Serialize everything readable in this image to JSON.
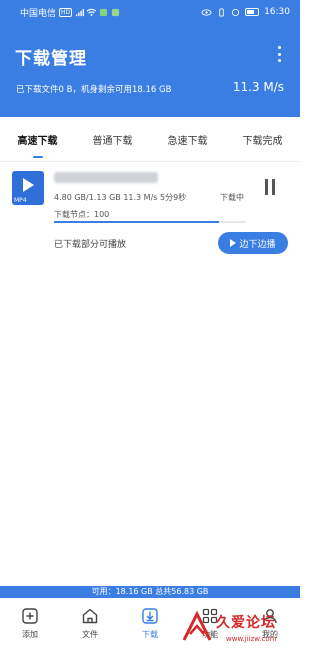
{
  "status_bar": {
    "carrier": "中国电信",
    "network": "HD",
    "time": "16:30"
  },
  "header": {
    "title": "下载管理",
    "storage_info": "已下载文件0 B，机身剩余可用18.16 GB",
    "speed": "11.3 M/s"
  },
  "tabs": [
    {
      "label": "高速下载",
      "active": true
    },
    {
      "label": "普通下载",
      "active": false
    },
    {
      "label": "急速下载",
      "active": false
    },
    {
      "label": "下载完成",
      "active": false
    }
  ],
  "download_item": {
    "file_format": "MP4",
    "file_name": "",
    "progress_text": "4.80 GB/1.13 GB  11.3 M/s  5分9秒",
    "status": "下载中",
    "nodes_text": "下载节点：100",
    "progress_fraction": 0.86,
    "partial_playable_text": "已下载部分可播放",
    "play_while_downloading_label": "边下边播"
  },
  "storage_bar": {
    "text": "可用：18.16 GB 总共56.83 GB"
  },
  "bottom_nav": [
    {
      "label": "添加",
      "icon": "add-icon",
      "active": false
    },
    {
      "label": "文件",
      "icon": "home-icon",
      "active": false
    },
    {
      "label": "下载",
      "icon": "download-icon",
      "active": true
    },
    {
      "label": "功能",
      "icon": "apps-icon",
      "active": false
    },
    {
      "label": "我的",
      "icon": "profile-icon",
      "active": false
    }
  ],
  "watermark": {
    "text": "久爱论坛",
    "url": "www.jiizw.com"
  },
  "colors": {
    "accent": "#3a7ee4",
    "watermark": "#d4282a"
  }
}
